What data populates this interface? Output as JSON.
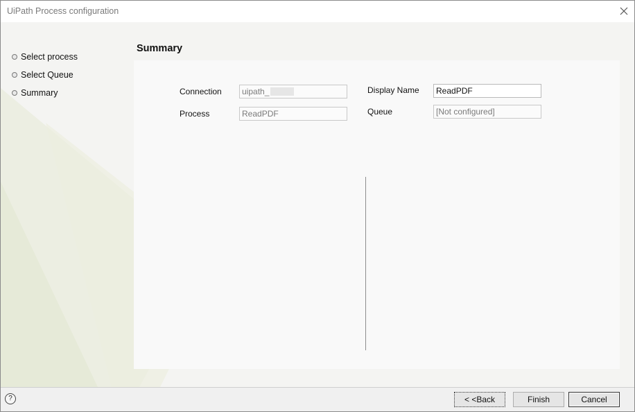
{
  "window": {
    "title": "UiPath Process configuration"
  },
  "steps": [
    {
      "label": "Select process"
    },
    {
      "label": "Select Queue"
    },
    {
      "label": "Summary"
    }
  ],
  "page": {
    "title": "Summary"
  },
  "summary": {
    "connection": {
      "label": "Connection",
      "value": "uipath_"
    },
    "process": {
      "label": "Process",
      "value": "ReadPDF"
    },
    "display_name": {
      "label": "Display Name",
      "value": "ReadPDF"
    },
    "queue": {
      "label": "Queue",
      "value": "[Not configured]"
    }
  },
  "footer": {
    "help_glyph": "?",
    "back_label": "< <Back",
    "finish_label": "Finish",
    "cancel_label": "Cancel"
  },
  "icons": [
    "close-icon",
    "help-icon",
    "step-bullet-icon"
  ]
}
